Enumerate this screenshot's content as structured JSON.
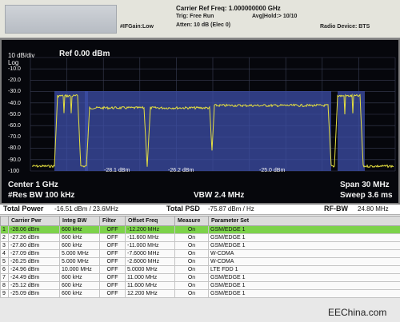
{
  "header": {
    "ifgain": "#IFGain:Low",
    "carrier_ref": "Carrier Ref Freq: 1.000000000 GHz",
    "trig": "Trig: Free Run",
    "avg_hold": "Avg|Hold:> 10/10",
    "atten": "Atten: 10 dB (Elec 0)",
    "radio_device": "Radio Device: BTS"
  },
  "screen": {
    "scale": "10 dB/div",
    "ref": "Ref 0.00 dBm",
    "log": "Log",
    "y_ticks": [
      "-10.0",
      "-20.0",
      "-30.0",
      "-40.0",
      "-50.0",
      "-60.0",
      "-70.0",
      "-80.0",
      "-90.0",
      "-100"
    ],
    "center": "Center 1 GHz",
    "res_bw": "#Res BW 100 kHz",
    "vbw": "VBW 2.4 MHz",
    "span": "Span 30 MHz",
    "sweep": "Sweep 3.6 ms",
    "channel_labels": [
      "-28.1 dBm",
      "-26.2 dBm",
      "-25.0 dBm"
    ],
    "colors": {
      "trace": "#e6e040",
      "channel_fill": "#3d4fa8",
      "grid": "#3a3f55"
    }
  },
  "summary": {
    "total_power_label": "Total Power",
    "total_power_value": "-16.51 dBm / 23.6MHz",
    "total_psd_label": "Total PSD",
    "total_psd_value": "-75.87 dBm / Hz",
    "rf_bw_label": "RF-BW",
    "rf_bw_value": "24.80 MHz"
  },
  "table": {
    "headers": [
      "Carrier Pwr",
      "Integ BW",
      "Filter",
      "Offset Freq",
      "Measure",
      "Parameter Set"
    ],
    "rows": [
      [
        "1",
        "-28.06 dBm",
        "600 kHz",
        "OFF",
        "-12.200 MHz",
        "On",
        "GSM/EDGE 1"
      ],
      [
        "2",
        "-27.26 dBm",
        "600 kHz",
        "OFF",
        "-11.600 MHz",
        "On",
        "GSM/EDGE 1"
      ],
      [
        "3",
        "-27.80 dBm",
        "600 kHz",
        "OFF",
        "-11.000 MHz",
        "On",
        "GSM/EDGE 1"
      ],
      [
        "4",
        "-27.09 dBm",
        "5.000 MHz",
        "OFF",
        "-7.6000 MHz",
        "On",
        "W-CDMA"
      ],
      [
        "5",
        "-26.25 dBm",
        "5.000 MHz",
        "OFF",
        "-2.6000 MHz",
        "On",
        "W-CDMA"
      ],
      [
        "6",
        "-24.96 dBm",
        "10.000 MHz",
        "OFF",
        "5.0000 MHz",
        "On",
        "LTE FDD 1"
      ],
      [
        "7",
        "-24.49 dBm",
        "600 kHz",
        "OFF",
        "11.000 MHz",
        "On",
        "GSM/EDGE 1"
      ],
      [
        "8",
        "-25.12 dBm",
        "600 kHz",
        "OFF",
        "11.600 MHz",
        "On",
        "GSM/EDGE 1"
      ],
      [
        "9",
        "-25.09 dBm",
        "600 kHz",
        "OFF",
        "12.200 MHz",
        "On",
        "GSM/EDGE 1"
      ]
    ],
    "selected_row": 0,
    "selected_color": "#7cd24a"
  },
  "watermark": "EEChina.com"
}
